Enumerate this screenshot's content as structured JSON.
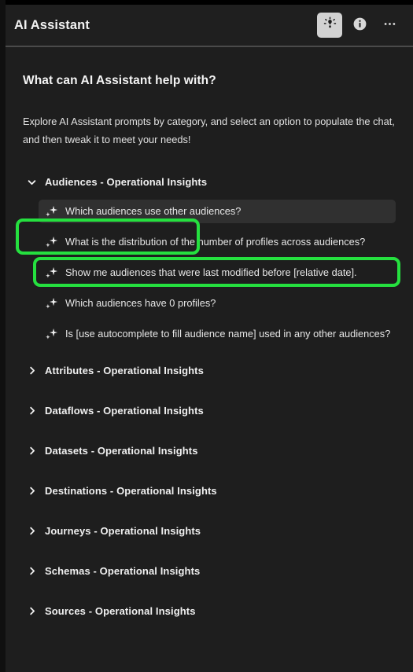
{
  "header": {
    "title": "AI Assistant",
    "actions": [
      {
        "name": "ideas-lightbulb-button",
        "icon": "lightbulb-icon",
        "selected": true
      },
      {
        "name": "info-button",
        "icon": "info-circle-icon",
        "selected": false
      },
      {
        "name": "more-options-button",
        "icon": "more-horizontal-icon",
        "selected": false
      }
    ]
  },
  "intro": {
    "title": "What can AI Assistant help with?",
    "description": "Explore AI Assistant prompts by category, and select an option to populate the chat, and then tweak it to meet your needs!"
  },
  "categories": [
    {
      "label": "Audiences - Operational Insights",
      "expanded": true,
      "chevron": "chevron-down-icon",
      "prompts": [
        {
          "label": "Which audiences use other audiences?",
          "active": true
        },
        {
          "label": "What is the distribution of the number of profiles across audiences?",
          "active": false
        },
        {
          "label": "Show me audiences that were last modified before [relative date].",
          "active": false
        },
        {
          "label": "Which audiences have 0 profiles?",
          "active": false
        },
        {
          "label": "Is [use autocomplete to fill audience name] used in any other audiences?",
          "active": false
        }
      ]
    },
    {
      "label": "Attributes - Operational Insights",
      "expanded": false,
      "chevron": "chevron-right-icon",
      "prompts": []
    },
    {
      "label": "Dataflows - Operational Insights",
      "expanded": false,
      "chevron": "chevron-right-icon",
      "prompts": []
    },
    {
      "label": "Datasets - Operational Insights",
      "expanded": false,
      "chevron": "chevron-right-icon",
      "prompts": []
    },
    {
      "label": "Destinations - Operational Insights",
      "expanded": false,
      "chevron": "chevron-right-icon",
      "prompts": []
    },
    {
      "label": "Journeys - Operational Insights",
      "expanded": false,
      "chevron": "chevron-right-icon",
      "prompts": []
    },
    {
      "label": "Schemas - Operational Insights",
      "expanded": false,
      "chevron": "chevron-right-icon",
      "prompts": []
    },
    {
      "label": "Sources - Operational Insights",
      "expanded": false,
      "chevron": "chevron-right-icon",
      "prompts": []
    }
  ],
  "annotations": [
    {
      "name": "highlight-audiences-category",
      "color": "#25e03f"
    },
    {
      "name": "highlight-active-prompt",
      "color": "#25e03f"
    }
  ],
  "colors": {
    "panel_background": "#1f1f1f",
    "body_background": "#1e1e1e",
    "active_row_background": "#303030",
    "selected_button_background": "#d2d2d2",
    "text_primary": "#f2f2f2",
    "text_secondary": "#e2e2e2",
    "annotation_green": "#25e03f"
  }
}
